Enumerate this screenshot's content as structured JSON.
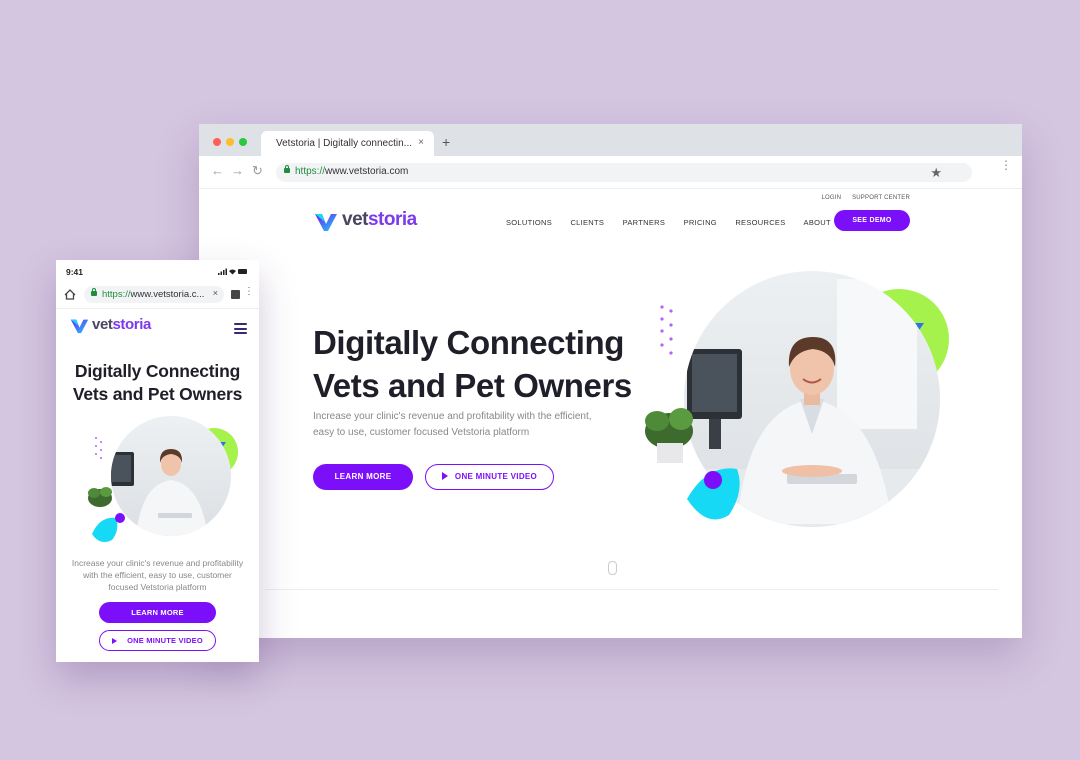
{
  "desktop": {
    "tab_title": "Vetstoria | Digitally connectin...",
    "tab_close": "×",
    "new_tab": "+",
    "url_scheme": "https://",
    "url_host": "www.vetstoria.com",
    "top_links": [
      "LOGIN",
      "SUPPORT CENTER"
    ],
    "logo": {
      "prefix": "vet",
      "suffix": "storia"
    },
    "nav": [
      "SOLUTIONS",
      "CLIENTS",
      "PARTNERS",
      "PRICING",
      "RESOURCES",
      "ABOUT"
    ],
    "demo_label": "SEE DEMO",
    "headline_1": "Digitally Connecting",
    "headline_2": "Vets and Pet Owners",
    "subtext": "Increase your clinic's revenue and profitability with the efficient, easy to use, customer focused Vetstoria platform",
    "learn_more": "LEARN MORE",
    "video_label": "ONE MINUTE VIDEO"
  },
  "mobile": {
    "time": "9:41",
    "url_scheme": "https://",
    "url_host": "www.vetstoria.c...",
    "url_close": "×",
    "logo": {
      "prefix": "vet",
      "suffix": "storia"
    },
    "headline_1": "Digitally Connecting",
    "headline_2": "Vets and Pet Owners",
    "subtext": "Increase your clinic's revenue and profitability with the efficient, easy to use, customer focused Vetstoria platform",
    "learn_more": "LEARN MORE",
    "video_label": "ONE MINUTE VIDEO"
  },
  "colors": {
    "brand_purple": "#7c0ffa",
    "accent_cyan": "#16d9f5",
    "accent_lime": "#a6f24c",
    "background": "#d4c5e0"
  },
  "icons": [
    "back-arrow-icon",
    "forward-arrow-icon",
    "reload-icon",
    "lock-icon",
    "star-icon",
    "menu-kebab-icon",
    "home-icon",
    "hamburger-icon",
    "play-icon"
  ]
}
